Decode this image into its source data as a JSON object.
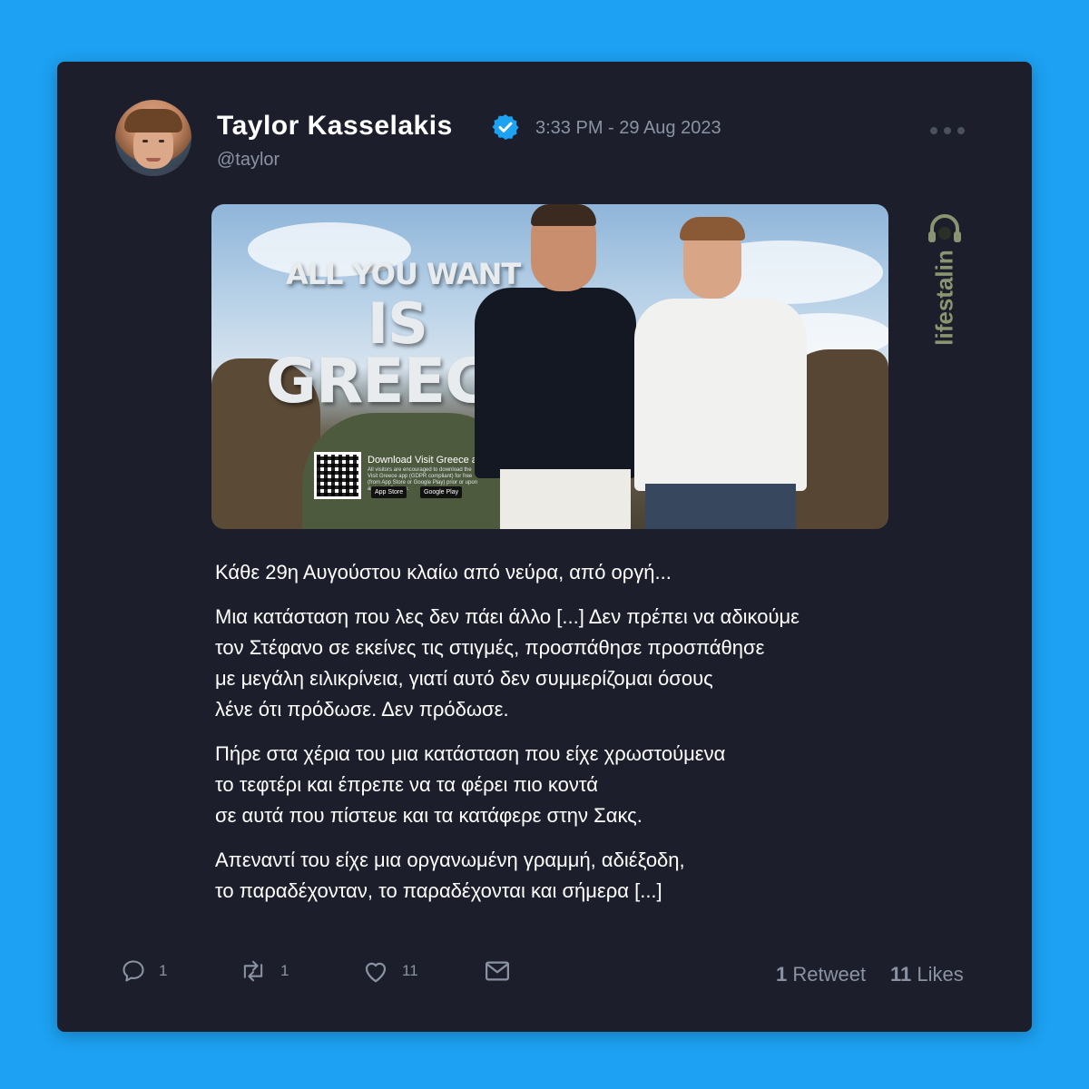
{
  "author": {
    "name": "Taylor Kasselakis",
    "handle": "@taylor",
    "timestamp": "3:33 PM - 29 Aug 2023",
    "verified_icon": "verified-badge-icon"
  },
  "media": {
    "ad_line1": "ALL YOU WANT",
    "ad_line2": "IS",
    "ad_line3": "GREEC",
    "download_text": "Download Visit Greece app",
    "download_subtext": "All visitors are encouraged to download the Visit Greece app (GDPR compliant) for free (from App Store or Google Play) prior or upon arrival in Greece.",
    "app_store": "App Store",
    "google_play": "Google Play"
  },
  "watermark": "lifestalin",
  "body": {
    "paragraphs": [
      [
        "Κάθε 29η Αυγούστου κλαίω από νεύρα, από οργή..."
      ],
      [
        "Μια κατάσταση που λες δεν πάει άλλο [...] Δεν πρέπει να αδικούμε",
        "τον Στέφανο σε εκείνες τις στιγμές, προσπάθησε προσπάθησε",
        "με μεγάλη ειλικρίνεια, γιατί αυτό δεν συμμερίζομαι όσους",
        "λένε ότι πρόδωσε. Δεν πρόδωσε."
      ],
      [
        "Πήρε στα χέρια του μια κατάσταση που είχε χρωστούμενα",
        "το τεφτέρι και έπρεπε να τα φέρει πιο κοντά",
        "σε αυτά που πίστευε και τα κατάφερε στην Σακς."
      ],
      [
        "Απεναντί του είχε μια οργανωμένη γραμμή, αδιέξοδη,",
        "το παραδέχονταν, το παραδέχονται και σήμερα  [...]"
      ]
    ]
  },
  "actions": {
    "reply_count": "1",
    "retweet_count": "1",
    "like_count": "11"
  },
  "stats": {
    "retweets_num": "1",
    "retweets_label": "Retweet",
    "likes_num": "11",
    "likes_label": "Likes"
  },
  "colors": {
    "page_background": "#1da1f2",
    "card_background": "#1c1f2b",
    "verified_blue": "#1da1f2",
    "muted_text": "#8a93a3"
  }
}
